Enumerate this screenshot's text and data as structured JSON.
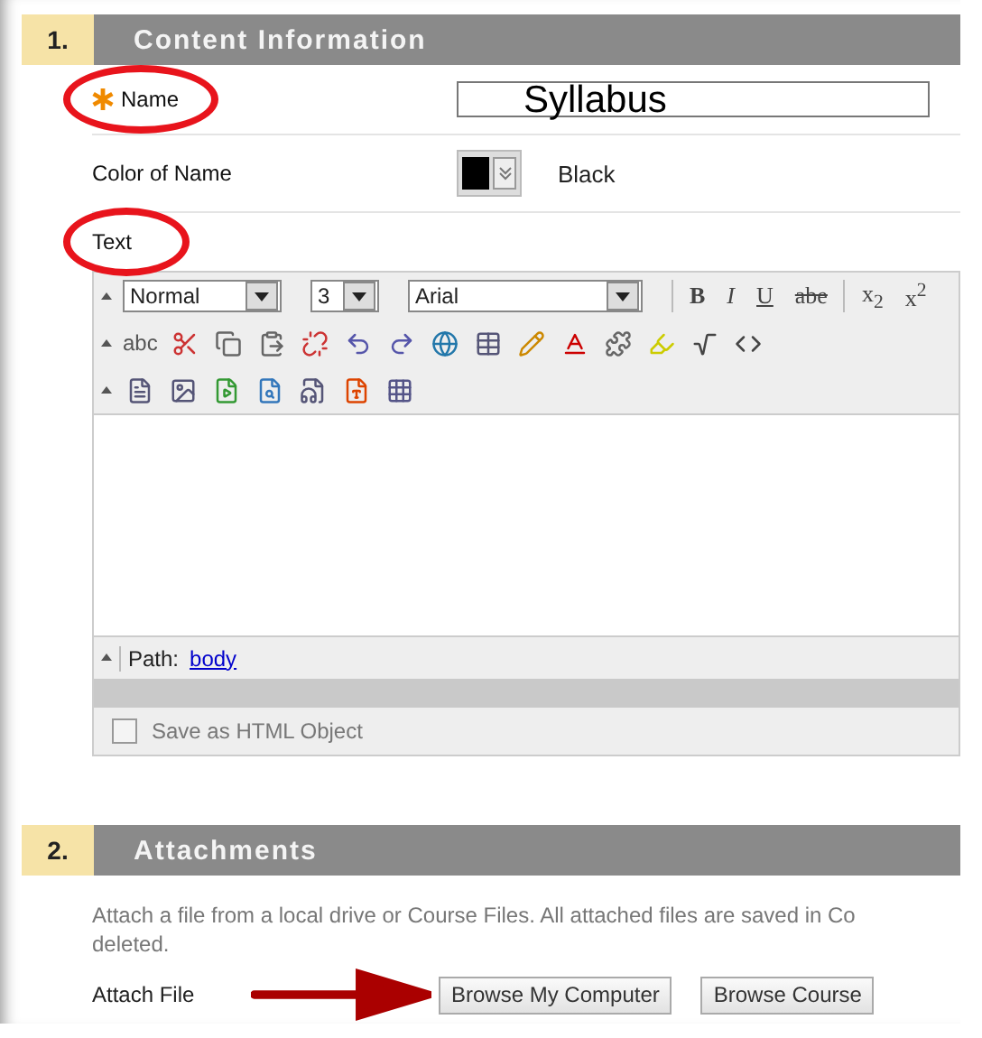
{
  "content_information": {
    "number": "1.",
    "title": "Content Information",
    "name_field": {
      "label": "Name",
      "required": true,
      "value": "Syllabus",
      "highlighted": true
    },
    "color_field": {
      "label": "Color of Name",
      "color": "#000000",
      "value": "Black"
    },
    "text_field": {
      "label": "Text",
      "highlighted": true
    },
    "editor": {
      "format": "Normal",
      "size": "3",
      "font": "Arial",
      "format_buttons": [
        "B",
        "I",
        "U",
        "abe",
        "x$_{2}$",
        "x$^{2}$"
      ],
      "spellcheck": "abc",
      "path_label": "Path:",
      "path_link": "body",
      "save_as_html": {
        "label": "Save as HTML Object",
        "checked": false
      }
    }
  },
  "attachments": {
    "number": "2.",
    "title": "Attachments",
    "description": [
      "Attach a file from a local drive or Course Files. All attached files are saved in Co",
      "deleted."
    ],
    "attach_label": "Attach File",
    "arrow": true,
    "buttons": [
      "Browse My Computer",
      "Browse Course"
    ]
  }
}
